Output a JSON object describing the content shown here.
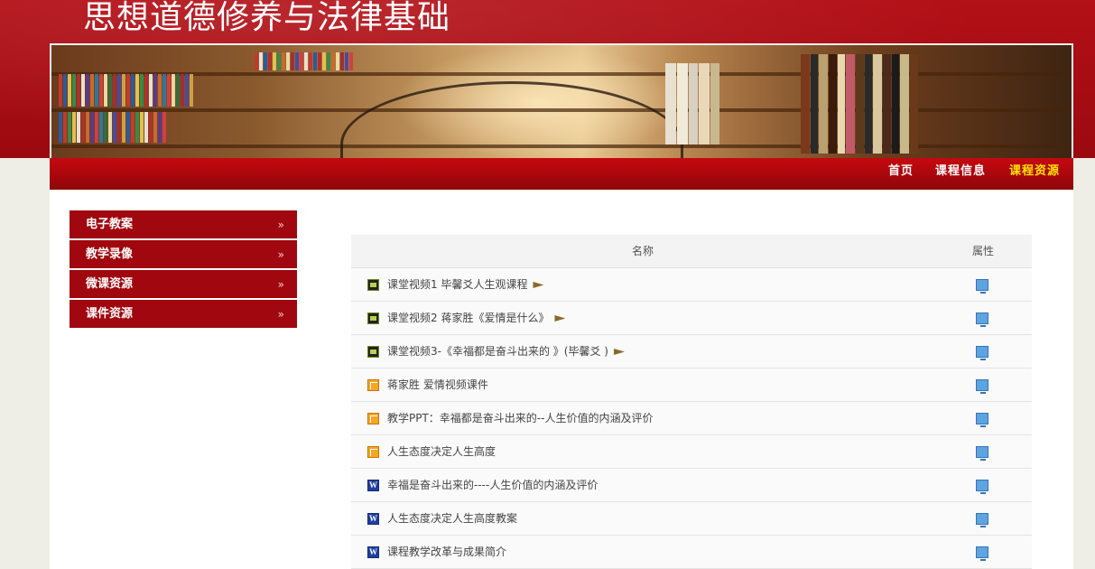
{
  "site": {
    "title": "思想道德修养与法律基础"
  },
  "nav": {
    "items": [
      {
        "label": "首页",
        "active": false
      },
      {
        "label": "课程信息",
        "active": false
      },
      {
        "label": "课程资源",
        "active": true
      }
    ]
  },
  "sidebar": {
    "items": [
      {
        "label": "电子教案",
        "chevron": "»"
      },
      {
        "label": "教学录像",
        "chevron": "»"
      },
      {
        "label": "微课资源",
        "chevron": "»"
      },
      {
        "label": "课件资源",
        "chevron": "»"
      }
    ]
  },
  "table": {
    "headers": {
      "name": "名称",
      "attr": "属性"
    },
    "rows": [
      {
        "icon": "video-file-icon",
        "name": "课堂视频1 毕馨爻人生观课程",
        "flag": true
      },
      {
        "icon": "video-file-icon",
        "name": "课堂视频2 蒋家胜《爱情是什么》",
        "flag": true
      },
      {
        "icon": "video-file-icon",
        "name": "课堂视频3-《幸福都是奋斗出来的 》(毕馨爻 )",
        "flag": true
      },
      {
        "icon": "ppt-file-icon",
        "name": "蒋家胜 爱情视频课件",
        "flag": false
      },
      {
        "icon": "ppt-file-icon",
        "name": "教学PPT：幸福都是奋斗出来的--人生价值的内涵及评价",
        "flag": false
      },
      {
        "icon": "ppt-file-icon",
        "name": "人生态度决定人生高度",
        "flag": false
      },
      {
        "icon": "word-file-icon",
        "name": "幸福是奋斗出来的----人生价值的内涵及评价",
        "flag": false
      },
      {
        "icon": "word-file-icon",
        "name": "人生态度决定人生高度教案",
        "flag": false
      },
      {
        "icon": "word-file-icon",
        "name": "课程教学改革与成果简介",
        "flag": false
      }
    ]
  },
  "colors": {
    "brand_red": "#a0070e",
    "nav_active": "#ffe400",
    "page_bg": "#efeee6"
  }
}
